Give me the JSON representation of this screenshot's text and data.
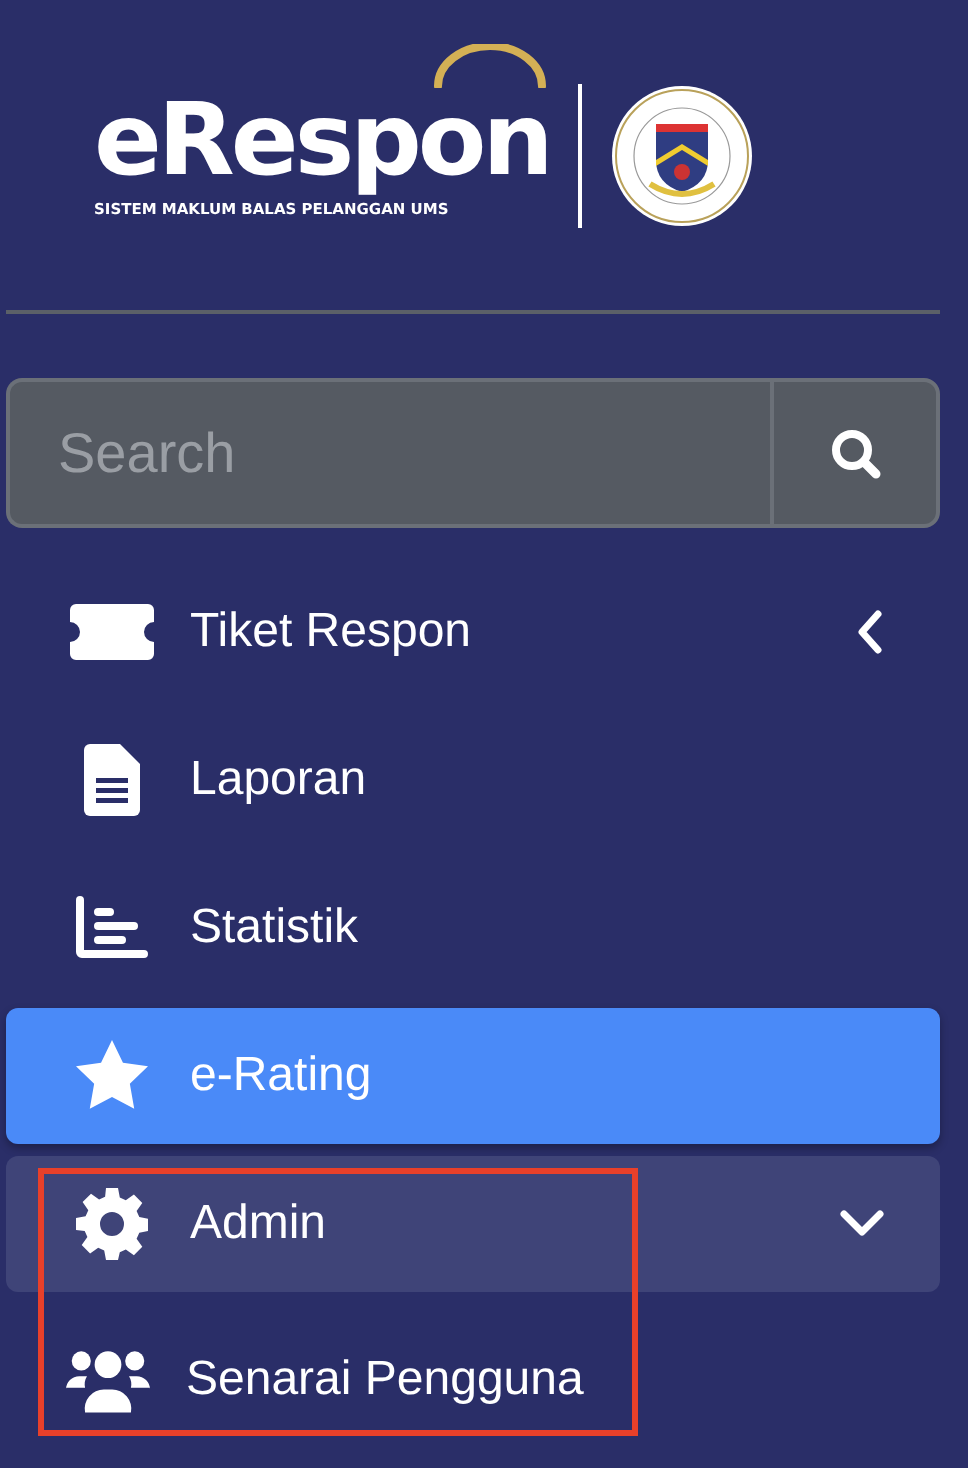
{
  "brand": {
    "name": "eRespon",
    "tagline": "SISTEM MAKLUM BALAS PELANGGAN UMS"
  },
  "search": {
    "placeholder": "Search"
  },
  "menu": [
    {
      "kind": "group",
      "label": "Tiket Respon",
      "selected": false,
      "expanded": false
    },
    {
      "kind": "link",
      "label": "Laporan",
      "selected": false
    },
    {
      "kind": "link",
      "label": "Statistik",
      "selected": false
    },
    {
      "kind": "link",
      "label": "e-Rating",
      "selected": true
    },
    {
      "kind": "group",
      "label": "Admin",
      "selected": false,
      "expanded": true,
      "children": [
        {
          "label": "Senarai Pengguna",
          "selected": false
        }
      ]
    }
  ],
  "annotation_frame": true
}
